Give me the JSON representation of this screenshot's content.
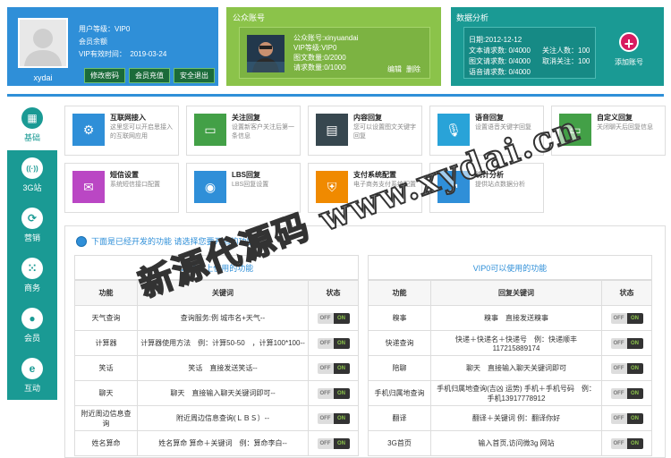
{
  "user": {
    "name": "xydai",
    "level_label": "用户等级：VIP0",
    "balance_label": "会员余额",
    "expire_label": "VIP有效时间：",
    "expire_date": "2019-03-24",
    "buttons": [
      "修改密码",
      "会员充值",
      "安全退出"
    ]
  },
  "public_account": {
    "title": "公众账号",
    "account": "公众账号:xinyuandai",
    "level": "VIP等级:VIP0",
    "images": "图文数量:0/2000",
    "requests": "请求数量:0/1000",
    "edit": "编辑",
    "delete": "删除"
  },
  "stats": {
    "title": "数据分析",
    "date": "日期:2012-12-12",
    "text_req": "文本请求数: 0/4000",
    "follow": "关注人数：100",
    "image_req": "图文请求数: 0/4000",
    "unfollow": "取消关注：100",
    "voice_req": "语音请求数: 0/4000",
    "add_account": "添加账号"
  },
  "sidebar": [
    {
      "label": "基础",
      "icon": "grid-icon",
      "glyph": "▦"
    },
    {
      "label": "3G站",
      "icon": "signal-icon",
      "glyph": "((·))"
    },
    {
      "label": "营销",
      "icon": "refresh-icon",
      "glyph": "⟳"
    },
    {
      "label": "商务",
      "icon": "dots-icon",
      "glyph": "⁙"
    },
    {
      "label": "会员",
      "icon": "user-icon",
      "glyph": "●"
    },
    {
      "label": "互动",
      "icon": "ie-icon",
      "glyph": "e"
    }
  ],
  "features": [
    {
      "title": "互联网接入",
      "desc": "这里您可以开启思接入的互联网应用",
      "color": "#2f8fd8",
      "icon": "gear-icon",
      "glyph": "⚙"
    },
    {
      "title": "关注回复",
      "desc": "设置新客户关注后第一条信息",
      "color": "#43a047",
      "icon": "chat-icon",
      "glyph": "▭"
    },
    {
      "title": "内容回复",
      "desc": "您可以设置图文关键字回复",
      "color": "#37474f",
      "icon": "document-icon",
      "glyph": "▤"
    },
    {
      "title": "语音回复",
      "desc": "设置语音关键字回复",
      "color": "#29a3d8",
      "icon": "microphone-icon",
      "glyph": "🎙"
    },
    {
      "title": "自定义回复",
      "desc": "关闭聊天后回复信息",
      "color": "#43a047",
      "icon": "chat-icon",
      "glyph": "▭"
    },
    {
      "title": "短信设置",
      "desc": "系统短信接口配置",
      "color": "#ba47c4",
      "icon": "mail-icon",
      "glyph": "✉"
    },
    {
      "title": "LBS回复",
      "desc": "LBS回复设置",
      "color": "#2f8fd8",
      "icon": "location-icon",
      "glyph": "◉"
    },
    {
      "title": "支付系统配置",
      "desc": "电子商务支付系统配置",
      "color": "#f08a00",
      "icon": "shield-icon",
      "glyph": "⛨"
    },
    {
      "title": "统计分析",
      "desc": "提供站点数据分析",
      "color": "#2f8fd8",
      "icon": "chart-icon",
      "glyph": "↗"
    }
  ],
  "notice": "下面是已经开发的功能 请选择您要开启的功能",
  "tables": {
    "left_title": "VIP0以上使用的功能",
    "right_title": "VIP0可以使用的功能",
    "headers": [
      "功能",
      "关键词",
      "状态"
    ],
    "right_headers": [
      "功能",
      "回复关键词",
      "状态"
    ],
    "toggle_off": "OFF",
    "toggle_on": "ON",
    "left_rows": [
      [
        "天气查询",
        "查询服务:例 城市名+天气--"
      ],
      [
        "计算器",
        "计算器使用方法　例：计算50-50　，计算100*100--"
      ],
      [
        "笑话",
        "笑话　直接发送笑话--"
      ],
      [
        "聊天",
        "聊天　直接输入聊天关键词即可--"
      ],
      [
        "附近周边信息查询",
        "附近周边信息查询(ＬＢＳ）--"
      ],
      [
        "姓名算命",
        "姓名算命 算命＋关键词　例：算命李白--"
      ]
    ],
    "right_rows": [
      [
        "糗事",
        "糗事　直接发送糗事"
      ],
      [
        "快递查询",
        "快递＋快递名＋快递号　例：快递顺丰117215889174"
      ],
      [
        "陪聊",
        "聊天　直接输入聊天关键词即可"
      ],
      [
        "手机归属地查询",
        "手机归属地查询(吉凶 运势) 手机＋手机号码　例：手机13917778912"
      ],
      [
        "翻译",
        "翻译＋关键词 例：翻译你好"
      ],
      [
        "3G首页",
        "输入首页,访问微3g 网站"
      ]
    ]
  },
  "watermark": "新源代源码 www.xydai.cn"
}
